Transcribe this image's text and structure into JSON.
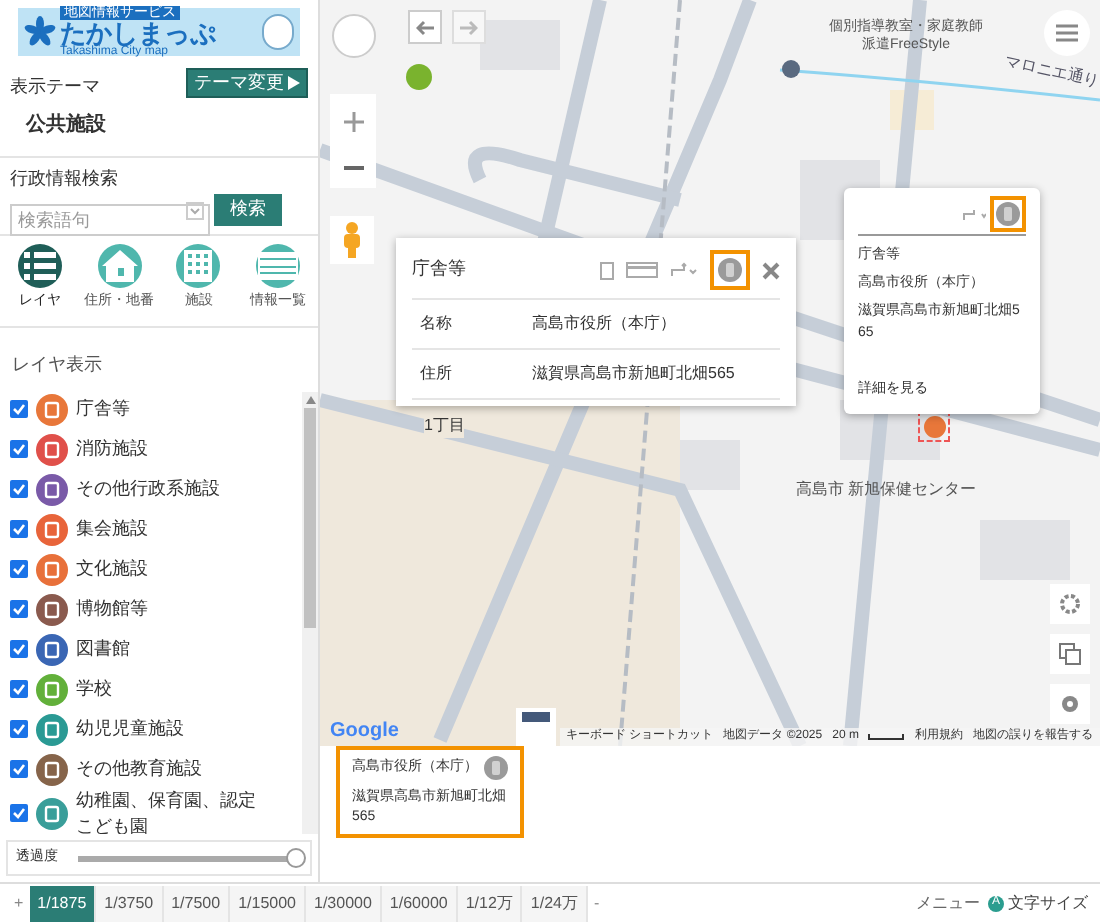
{
  "logo": {
    "subtitle": "地図情報サービス",
    "title": "たかしまっぷ",
    "romaji": "Takashima City map"
  },
  "theme": {
    "label": "表示テーマ",
    "button": "テーマ変更",
    "value": "公共施設"
  },
  "search": {
    "label": "行政情報検索",
    "placeholder": "検索語句",
    "button": "検索"
  },
  "nav": [
    {
      "kind": "layers",
      "label": "レイヤ",
      "selected": true
    },
    {
      "kind": "home",
      "label": "住所・地番",
      "selected": false
    },
    {
      "kind": "building",
      "label": "施設",
      "selected": false
    },
    {
      "kind": "list",
      "label": "情報一覧",
      "selected": false
    }
  ],
  "layers": {
    "title": "レイヤ表示",
    "items": [
      {
        "label": "庁舎等",
        "checked": true,
        "color": "#e8773a"
      },
      {
        "label": "消防施設",
        "checked": true,
        "color": "#e0504a"
      },
      {
        "label": "その他行政系施設",
        "checked": true,
        "color": "#7a5aa8"
      },
      {
        "label": "集会施設",
        "checked": true,
        "color": "#e8643a"
      },
      {
        "label": "文化施設",
        "checked": true,
        "color": "#e8703a"
      },
      {
        "label": "博物館等",
        "checked": true,
        "color": "#8a5a4e"
      },
      {
        "label": "図書館",
        "checked": true,
        "color": "#3a66b4"
      },
      {
        "label": "学校",
        "checked": true,
        "color": "#62b03a"
      },
      {
        "label": "幼児児童施設",
        "checked": true,
        "color": "#2a9a94"
      },
      {
        "label": "その他教育施設",
        "checked": true,
        "color": "#86644a"
      },
      {
        "label": "幼稚園、保育園、認定こども園",
        "checked": true,
        "color": "#3a9e9a"
      }
    ]
  },
  "opacity": {
    "label": "透過度",
    "level": 0.97
  },
  "scales": {
    "plus": "+",
    "items": [
      {
        "label": "1/1875",
        "selected": true
      },
      {
        "label": "1/3750",
        "selected": false
      },
      {
        "label": "1/7500",
        "selected": false
      },
      {
        "label": "1/15000",
        "selected": false
      },
      {
        "label": "1/30000",
        "selected": false
      },
      {
        "label": "1/60000",
        "selected": false
      },
      {
        "label": "1/12万",
        "selected": false
      },
      {
        "label": "1/24万",
        "selected": false
      }
    ],
    "minus": "-"
  },
  "footer": {
    "menu": "メニュー",
    "font_badge": "A",
    "font_size": "文字サイズ"
  },
  "map": {
    "labels": [
      "1丁目",
      "高島市 新旭保健センター"
    ],
    "poi": "個別指導教室・家庭教師派遣FreeStyle",
    "street": "マロニエ通り",
    "google": "Google",
    "keyboard": "キーボード ショートカット",
    "data": "地図データ ©2025",
    "scale": "20 m",
    "terms": "利用規約",
    "report": "地図の誤りを報告する"
  },
  "popup": {
    "title": "庁舎等",
    "rows": [
      {
        "label": "名称",
        "value": "高島市役所（本庁）"
      },
      {
        "label": "住所",
        "value": "滋賀県高島市新旭町北畑565"
      }
    ]
  },
  "infowindow": {
    "category": "庁舎等",
    "name": "高島市役所（本庁）",
    "address": "滋賀県高島市新旭町北畑565",
    "link": "詳細を見る"
  },
  "selected_info": {
    "name": "高島市役所（本庁）",
    "address": "滋賀県高島市新旭町北畑565"
  }
}
